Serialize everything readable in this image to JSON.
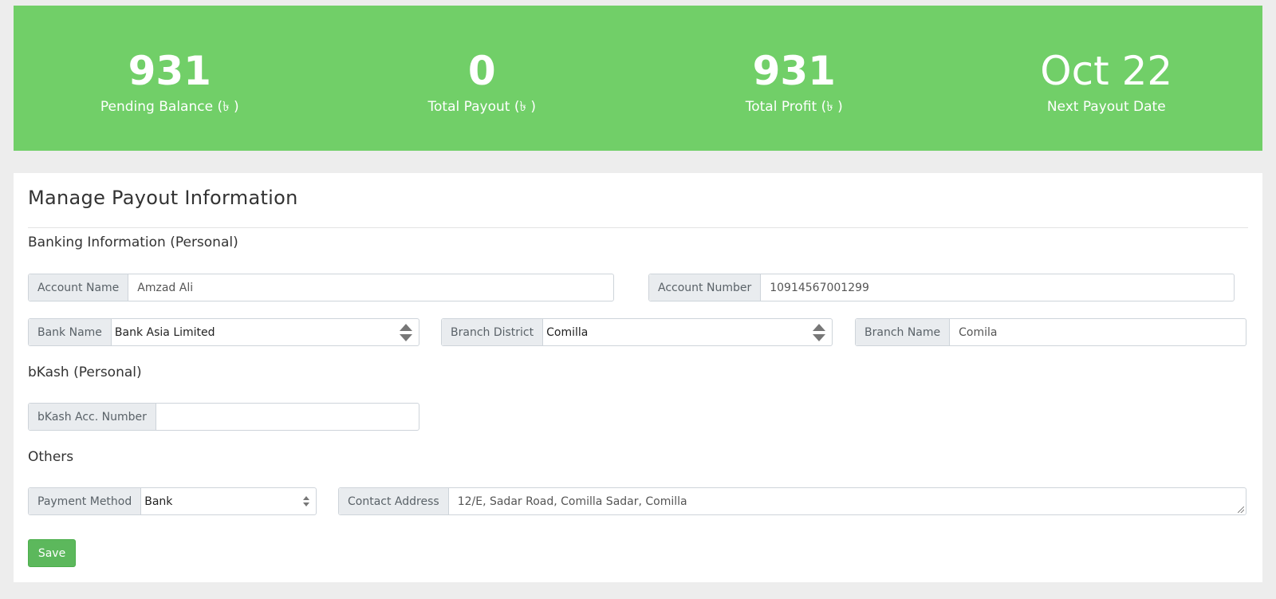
{
  "stats": [
    {
      "value": "931",
      "label": "Pending Balance (৳ )"
    },
    {
      "value": "0",
      "label": "Total Payout (৳ )"
    },
    {
      "value": "931",
      "label": "Total Profit (৳ )"
    },
    {
      "value": "Oct 22",
      "label": "Next Payout Date"
    }
  ],
  "panel": {
    "title": "Manage Payout Information"
  },
  "banking": {
    "section_title": "Banking Information (Personal)",
    "account_name_label": "Account Name",
    "account_name_value": "Amzad Ali",
    "account_number_label": "Account Number",
    "account_number_value": "10914567001299",
    "bank_name_label": "Bank Name",
    "bank_name_value": "Bank Asia Limited",
    "branch_district_label": "Branch District",
    "branch_district_value": "Comilla",
    "branch_name_label": "Branch Name",
    "branch_name_value": "Comila"
  },
  "bkash": {
    "section_title": "bKash (Personal)",
    "acc_number_label": "bKash Acc. Number",
    "acc_number_value": ""
  },
  "others": {
    "section_title": "Others",
    "payment_method_label": "Payment Method",
    "payment_method_value": "Bank",
    "contact_address_label": "Contact Address",
    "contact_address_value": "12/E, Sadar Road, Comilla Sadar, Comilla"
  },
  "actions": {
    "save_label": "Save"
  },
  "colors": {
    "stats_bg": "#71cf68",
    "save_button": "#5cb85c"
  }
}
